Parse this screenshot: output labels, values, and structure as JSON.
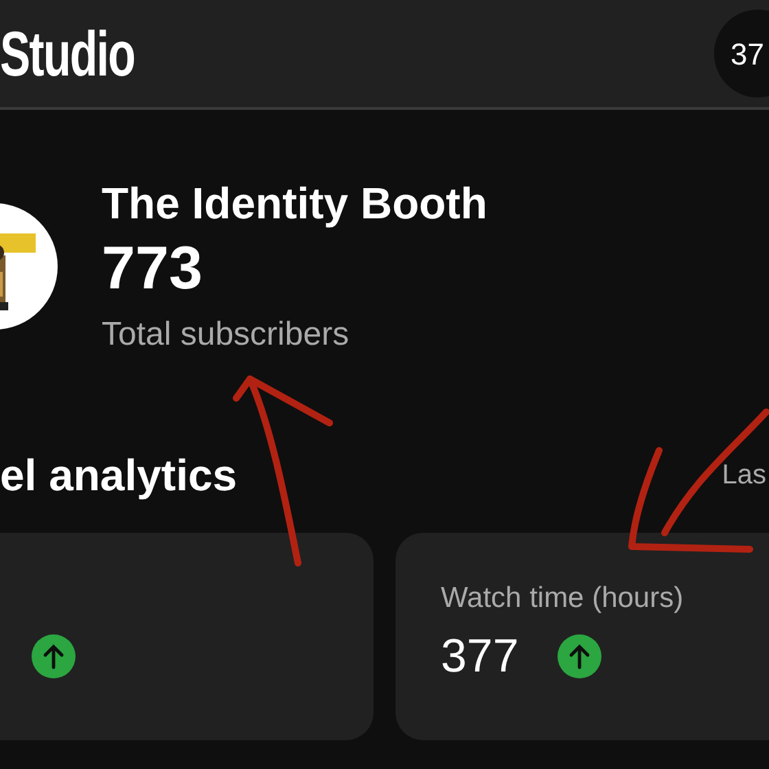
{
  "header": {
    "title": "Studio",
    "avatar_text": "37"
  },
  "channel": {
    "name": "The Identity Booth",
    "subscribers": "773",
    "subscribers_label": "Total subscribers"
  },
  "analytics": {
    "title": "el analytics",
    "period": "Las",
    "cards": [
      {
        "trend_up": true
      },
      {
        "label": "Watch time (hours)",
        "value": "377",
        "trend_up": true
      }
    ]
  }
}
